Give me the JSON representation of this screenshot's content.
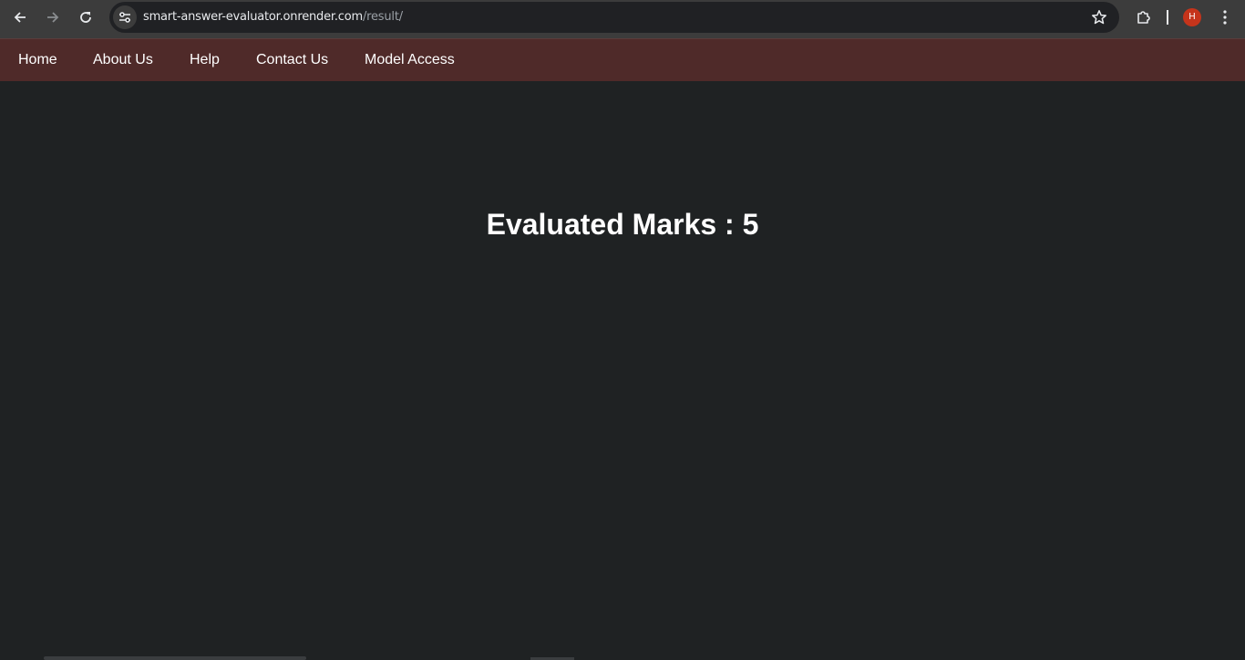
{
  "browser": {
    "url_host": "smart-answer-evaluator.onrender.com",
    "url_path": "/result/",
    "profile_initial": "H",
    "icons": {
      "back": "back-arrow-icon",
      "forward": "forward-arrow-icon",
      "reload": "reload-icon",
      "site_info": "tune-icon",
      "bookmark": "star-icon",
      "extensions": "puzzle-icon",
      "menu": "kebab-menu-icon"
    },
    "colors": {
      "toolbar": "#3c3c3c",
      "omnibox": "#202124",
      "avatar": "#c5341b"
    }
  },
  "site_nav": {
    "items": [
      {
        "label": "Home"
      },
      {
        "label": "About Us"
      },
      {
        "label": "Help"
      },
      {
        "label": "Contact Us"
      },
      {
        "label": "Model Access"
      }
    ],
    "background": "#4f2a29"
  },
  "result": {
    "heading": "Evaluated Marks : 5"
  },
  "page": {
    "background": "#1f2223"
  }
}
